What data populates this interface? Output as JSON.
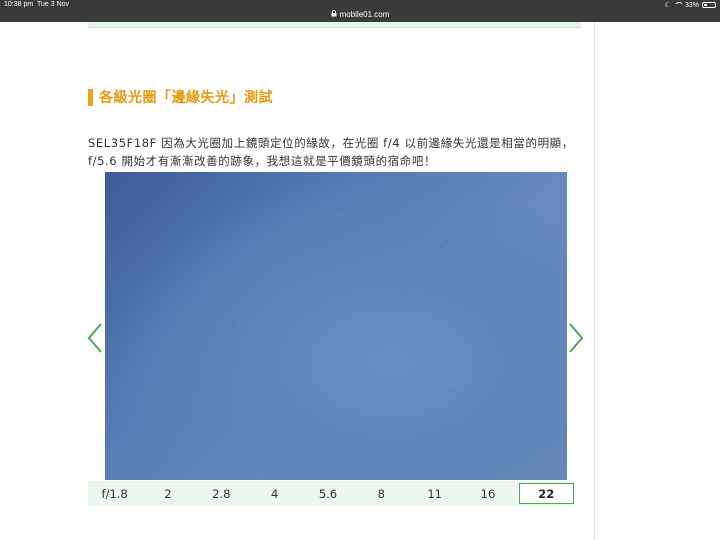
{
  "status_bar": {
    "time": "10:38 pm",
    "date": "Tue 3 Nov",
    "url": "mobile01.com",
    "battery": "33%"
  },
  "article": {
    "section_title": "各級光圈「邊緣失光」測試",
    "paragraph_line1": "SEL35F18F 因為大光圈加上鏡頭定位的緣故，在光圈 f/4 以前邊緣失光還是相當的明顯，",
    "paragraph_line2": "f/5.6 開始才有漸漸改善的跡象，我想這就是平價鏡頭的宿命吧！"
  },
  "gallery": {
    "apertures": [
      "f/1.8",
      "2",
      "2.8",
      "4",
      "5.6",
      "8",
      "11",
      "16",
      "22"
    ],
    "selected": "22"
  },
  "colors": {
    "accent_orange": "#f0a21a",
    "accent_green": "#49a85a"
  }
}
